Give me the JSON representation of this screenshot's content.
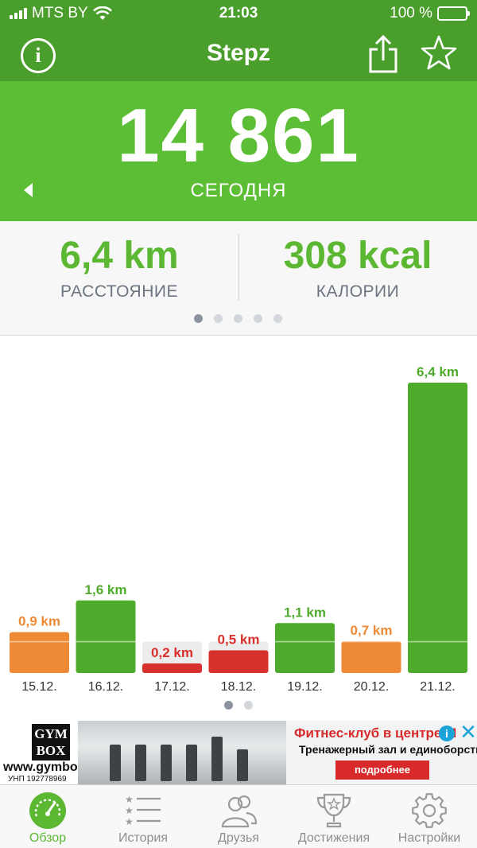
{
  "status_bar": {
    "carrier": "MTS BY",
    "time": "21:03",
    "battery": "100 %"
  },
  "nav": {
    "title": "Stepz",
    "info_glyph": "i"
  },
  "hero": {
    "steps": "14 861",
    "day_label": "СЕГОДНЯ"
  },
  "stats": {
    "distance_value": "6,4 km",
    "distance_label": "РАССТОЯНИЕ",
    "calories_value": "308 kcal",
    "calories_label": "КАЛОРИИ",
    "page_dots": 5,
    "active_page": 0
  },
  "chart_data": {
    "type": "bar",
    "categories": [
      "15.12.",
      "16.12.",
      "17.12.",
      "18.12.",
      "19.12.",
      "20.12.",
      "21.12."
    ],
    "values": [
      0.9,
      1.6,
      0.2,
      0.5,
      1.1,
      0.7,
      6.4
    ],
    "labels": [
      "0,9 km",
      "1,6 km",
      "0,2 km",
      "0,5 km",
      "1,1 km",
      "0,7 km",
      "6,4 km"
    ],
    "goal": 1.0,
    "ylim": [
      0,
      6.4
    ],
    "colors": [
      "#ee8a35",
      "#4fab2c",
      "#d8302a",
      "#d8302a",
      "#4fab2c",
      "#ee8a35",
      "#4fab2c"
    ],
    "page_dots": 2,
    "active_page": 0
  },
  "ad": {
    "logo_line1": "GYM",
    "logo_line2": "BOX",
    "url": "www.gymbox.by",
    "unp": "УНП 192778969",
    "headline": "Фитнес-клуб в центре М",
    "subline": "Тренажерный зал и единоборства",
    "cta": "подробнее"
  },
  "tabs": [
    {
      "label": "Обзор",
      "icon": "speedometer-icon",
      "active": true
    },
    {
      "label": "История",
      "icon": "star-list-icon",
      "active": false
    },
    {
      "label": "Друзья",
      "icon": "people-icon",
      "active": false
    },
    {
      "label": "Достижения",
      "icon": "trophy-icon",
      "active": false
    },
    {
      "label": "Настройки",
      "icon": "gear-icon",
      "active": false
    }
  ],
  "colors": {
    "header_green": "#4a9e2b",
    "hero_green": "#5cbe34",
    "text_green": "#5cb832",
    "orange": "#ee8a35",
    "red": "#d8302a"
  }
}
